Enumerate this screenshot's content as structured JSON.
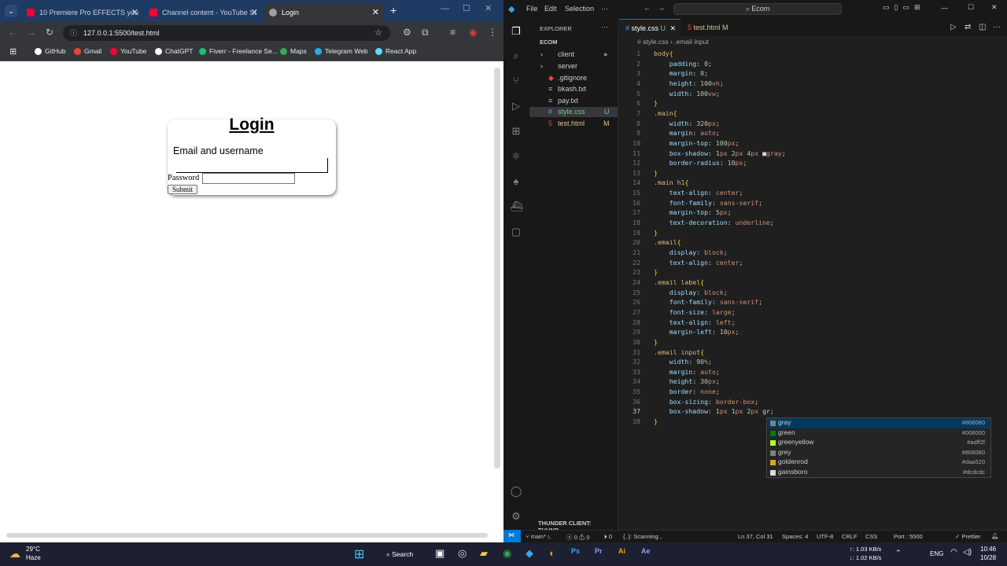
{
  "browser": {
    "tabs": [
      {
        "label": "10 Premiere Pro EFFECTS you",
        "color": "#ff0033"
      },
      {
        "label": "Channel content - YouTube St",
        "color": "#ff0033"
      },
      {
        "label": "Login",
        "color": "#9aa0a6"
      }
    ],
    "url": "127.0.0.1:5500/test.html",
    "bookmarks": [
      {
        "label": "GitHub",
        "color": "#fff"
      },
      {
        "label": "Gmail",
        "color": "#ea4335"
      },
      {
        "label": "YouTube",
        "color": "#ff0033"
      },
      {
        "label": "ChatGPT",
        "color": "#ffffff"
      },
      {
        "label": "Fiverr - Freelance Se...",
        "color": "#1dbf73"
      },
      {
        "label": "Maps",
        "color": "#34a853"
      },
      {
        "label": "Telegram Web",
        "color": "#2aabee"
      },
      {
        "label": "React App",
        "color": "#61dafb"
      }
    ]
  },
  "page": {
    "title": "Login",
    "email_label": "Email and username",
    "password_label": "Password",
    "submit_label": "Submit"
  },
  "vscode": {
    "menu": [
      "File",
      "Edit",
      "Selection",
      "···"
    ],
    "search": "Ecom",
    "explorer_title": "EXPLORER",
    "root": "ECOM",
    "files": [
      {
        "name": "client",
        "badge": "●",
        "color": "#ccc"
      },
      {
        "name": "server",
        "badge": "",
        "color": "#ccc"
      },
      {
        "name": ".gitignore",
        "badge": "",
        "color": "#ccc"
      },
      {
        "name": "bkash.txt",
        "badge": "",
        "color": "#ccc"
      },
      {
        "name": "pay.txt",
        "badge": "",
        "color": "#ccc"
      },
      {
        "name": "style.css",
        "badge": "U",
        "color": "#73c991"
      },
      {
        "name": "test.html",
        "badge": "M",
        "color": "#e2c08d"
      }
    ],
    "thunder": "THUNDER CLIENT: THUND...",
    "tabs": [
      {
        "label": "style.css",
        "badge": "U"
      },
      {
        "label": "test.html",
        "badge": "M"
      }
    ],
    "breadcrumb": [
      "style.css",
      ".email input"
    ],
    "suggestions": [
      {
        "name": "gray",
        "hex": "#808080",
        "color": "#808080"
      },
      {
        "name": "green",
        "hex": "#008000",
        "color": "#008000"
      },
      {
        "name": "greenyellow",
        "hex": "#adff2f",
        "color": "#adff2f"
      },
      {
        "name": "grey",
        "hex": "#808080",
        "color": "#808080"
      },
      {
        "name": "goldenrod",
        "hex": "#daa520",
        "color": "#daa520"
      },
      {
        "name": "gainsboro",
        "hex": "#dcdcdc",
        "color": "#dcdcdc"
      }
    ],
    "status": {
      "branch": "main*",
      "errors": "ⓧ 0 ⚠ 0",
      "tasks": "⏵ 0",
      "scanning": "{..}: Scanning...",
      "position": "Ln 37, Col 31",
      "spaces": "Spaces: 4",
      "encoding": "UTF-8",
      "eol": "CRLF",
      "lang": "CSS",
      "port": "Port : 5500",
      "prettier": "✓ Prettier"
    }
  },
  "taskbar": {
    "weather_temp": "29°C",
    "weather_desc": "Haze",
    "search": "Search",
    "net_up": "↑: 1.03 KB/s",
    "net_down": "↓: 1.02 KB/s",
    "lang": "ENG",
    "time": "10:46",
    "date": "10/28"
  }
}
